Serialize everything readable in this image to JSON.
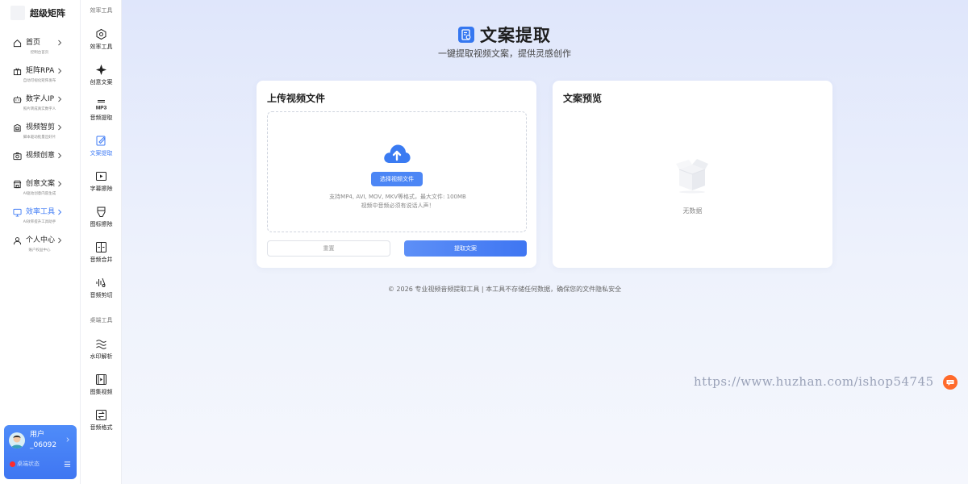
{
  "app": {
    "brand": "超级矩阵"
  },
  "sidebar": {
    "items": [
      {
        "label": "首页",
        "sub": "控制台首页",
        "icon": "home-icon"
      },
      {
        "label": "矩阵RPA",
        "sub": "自动可视化矩阵发布",
        "icon": "gift-box-icon"
      },
      {
        "label": "数字人IP",
        "sub": "照片转成真实数字人",
        "icon": "robot-icon"
      },
      {
        "label": "视频智剪",
        "sub": "脚本驱动批量出好片",
        "icon": "film-icon"
      },
      {
        "label": "视频创意",
        "sub": "",
        "icon": "camera-icon"
      },
      {
        "label": "创意文案",
        "sub": "AI驱动创意内容生成",
        "icon": "storefront-icon"
      },
      {
        "label": "效率工具",
        "sub": "AI效率提升工具助手",
        "icon": "monitor-icon"
      },
      {
        "label": "个人中心",
        "sub": "账户权益中心",
        "icon": "user-icon"
      }
    ],
    "active_index": 6,
    "user": {
      "name": "用户_06092",
      "status": "桌端状态"
    }
  },
  "toolbar": {
    "section_efficiency": "效率工具",
    "section_desktop": "桌端工具",
    "tools": [
      {
        "label": "效率工具",
        "icon": "network-icon"
      },
      {
        "label": "创意文案",
        "icon": "sparkle-icon"
      },
      {
        "label": "音频提取",
        "icon": "mp3-icon",
        "glyph": "MP3"
      },
      {
        "label": "文案提取",
        "icon": "edit-document-icon"
      },
      {
        "label": "字幕擦除",
        "icon": "subtitle-icon"
      },
      {
        "label": "图标擦除",
        "icon": "eraser-icon"
      },
      {
        "label": "音频合并",
        "icon": "merge-icon"
      },
      {
        "label": "音频剪切",
        "icon": "audio-cut-icon"
      },
      {
        "label": "水印解析",
        "icon": "waves-icon"
      },
      {
        "label": "图集视频",
        "icon": "video-frame-icon"
      },
      {
        "label": "音频格式",
        "icon": "convert-icon"
      }
    ],
    "active_index": 3
  },
  "main": {
    "title": "文案提取",
    "subtitle": "一键提取视频文案，提供灵感创作",
    "upload": {
      "title": "上传视频文件",
      "pick_button": "选择视频文件",
      "hint1": "支持MP4, AVI, MOV, MKV等格式，最大文件: 100MB",
      "hint2": "视频中音频必须有说话人声！",
      "reset_button": "重置",
      "extract_button": "提取文案"
    },
    "preview": {
      "title": "文案预览",
      "empty": "无数据"
    },
    "footer": "© 2026 专业视频音频提取工具 | 本工具不存储任何数据，确保您的文件隐私安全",
    "watermark": "https://www.huzhan.com/ishop54745"
  },
  "colors": {
    "accent": "#3f7bf5",
    "status_dot": "#ff2b2b",
    "chat": "#ff6a2b"
  }
}
